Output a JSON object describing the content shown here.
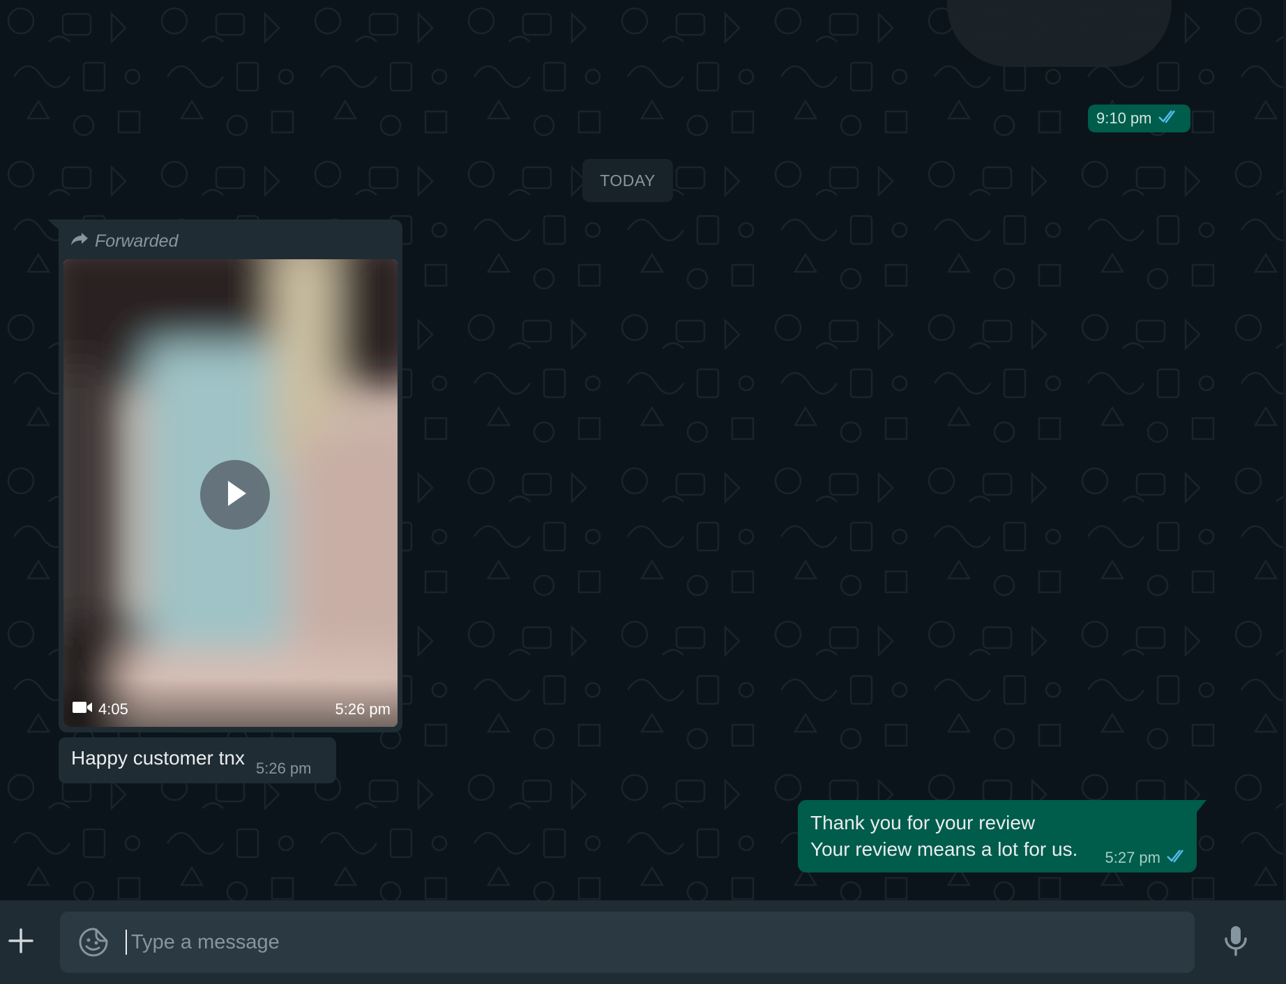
{
  "window": {
    "title": ""
  },
  "colors": {
    "background": "#0b141a",
    "incoming_bubble": "#202c33",
    "outgoing_bubble": "#005c4b",
    "read_ticks": "#53bdeb",
    "muted_text": "#8696a0"
  },
  "chat": {
    "prev_message": {
      "time": "9:10 pm",
      "status": "read",
      "status_icon": "double-check-icon"
    },
    "date_divider": "TODAY",
    "video_message": {
      "forwarded_label": "Forwarded",
      "duration": "4:05",
      "time": "5:26 pm",
      "media_icon": "video-camera-icon",
      "play_icon": "play-icon"
    },
    "caption_message": {
      "text": "Happy customer tnx",
      "time": "5:26 pm"
    },
    "outgoing_message": {
      "lines": [
        "Thank you for your review",
        "Your review means a lot for us."
      ],
      "time": "5:27 pm",
      "status": "read",
      "status_icon": "double-check-icon"
    }
  },
  "composer": {
    "placeholder": "Type a message",
    "value": "",
    "attach_icon": "plus-icon",
    "sticker_icon": "sticker-icon",
    "mic_icon": "microphone-icon"
  }
}
